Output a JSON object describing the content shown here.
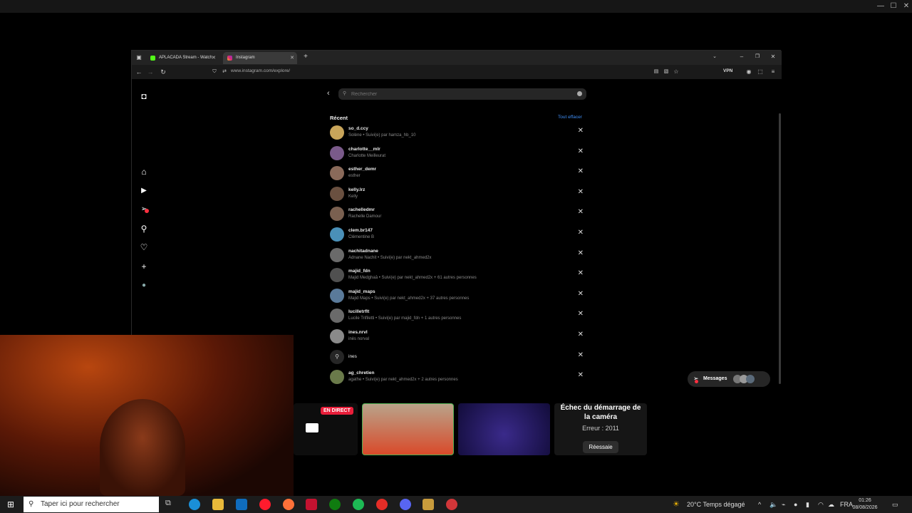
{
  "browser": {
    "tabs": [
      {
        "label": "APLACADA Stream - Watch"
      },
      {
        "label": "Instagram"
      }
    ],
    "url": "www.instagram.com/explore/",
    "vpn_label": "VPN"
  },
  "instagram": {
    "search": {
      "placeholder": "Rechercher"
    },
    "recent_label": "Récent",
    "clear_all_label": "Tout effacer",
    "messages_label": "Messages",
    "recent": [
      {
        "name": "so_d.ccy",
        "sub": "Solène • Suivi(e) par hamza_hb_10",
        "color": "#c9a55a"
      },
      {
        "name": "charlotte__mlr",
        "sub": "Charlotte Meilleurat",
        "color": "#7a5a8a"
      },
      {
        "name": "esther_demr",
        "sub": "esther",
        "color": "#8a6a5a"
      },
      {
        "name": "kelly.lrz",
        "sub": "Kelly",
        "color": "#6a5040"
      },
      {
        "name": "rachelledmr",
        "sub": "Rachelle Damour",
        "color": "#7a6050"
      },
      {
        "name": "clem.br147",
        "sub": "Clémentine B",
        "color": "#4a90b8"
      },
      {
        "name": "nachitadnane",
        "sub": "Adnane Nachit • Suivi(e) par nekt_ahmed2x",
        "color": "#6a6a6a"
      },
      {
        "name": "majid_fdn",
        "sub": "Majid Medghaâ • Suivi(e) par nekt_ahmed2x + 61 autres personnes",
        "color": "#505050"
      },
      {
        "name": "majid_maps",
        "sub": "Majid Maps • Suivi(e) par nekt_ahmed2x + 37 autres personnes",
        "color": "#5a7a9a"
      },
      {
        "name": "lucilletrflt",
        "sub": "Lucile Trifiletti • Suivi(e) par majid_fdn + 1 autres personnes",
        "color": "#6a6a6a"
      },
      {
        "name": "ines.nrvl",
        "sub": "inès norval",
        "color": "#8a8a8a"
      },
      {
        "name": "ines",
        "sub": "",
        "color": "#262626"
      },
      {
        "name": "ag_chretien",
        "sub": "agathe • Suivi(e) par nekt_ahmed2x + 2 autres personnes",
        "color": "#6a7a4a"
      }
    ]
  },
  "live": {
    "badge": "EN DIRECT",
    "error_title": "Échec du démarrage de la caméra",
    "error_code": "Erreur : 2011",
    "retry_label": "Réessaie"
  },
  "taskbar": {
    "search_placeholder": "Taper ici pour rechercher",
    "weather": "20°C  Temps dégagé",
    "lang": "FRA",
    "time": "01:26",
    "date": "08/08/2026"
  }
}
